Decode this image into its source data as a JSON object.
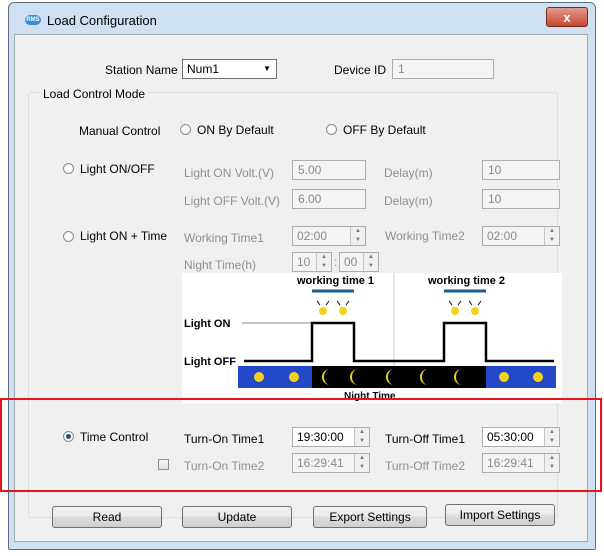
{
  "window": {
    "title": "Load Configuration",
    "close_symbol": "x",
    "app_icon_text": "RMS"
  },
  "station": {
    "label": "Station Name",
    "value": "Num1"
  },
  "device": {
    "label": "Device ID",
    "value": "1"
  },
  "group_label": "Load Control Mode",
  "manual": {
    "label": "Manual Control",
    "on_default": "ON By Default",
    "off_default": "OFF By Default"
  },
  "light_onoff": {
    "label": "Light ON/OFF",
    "on_volt_label": "Light ON  Volt.(V)",
    "on_volt": "5.00",
    "off_volt_label": "Light OFF Volt.(V)",
    "off_volt": "6.00",
    "delay_label": "Delay(m)",
    "delay1": "10",
    "delay2": "10"
  },
  "light_time": {
    "label": "Light ON + Time",
    "wt1_label": "Working Time1",
    "wt1": "02:00",
    "wt2_label": "Working Time2",
    "wt2": "02:00",
    "night_label": "Night Time(h)",
    "night_h": "10",
    "sep": ":",
    "night_m": "00"
  },
  "diagram": {
    "wt1": "working time 1",
    "wt2": "working time 2",
    "light_on": "Light ON",
    "light_off": "Light OFF",
    "night": "Night Time",
    "colors": {
      "sun_bg": "#2449c8",
      "moon_bg": "#000000",
      "sun": "#f5d21a"
    }
  },
  "time_control": {
    "label": "Time Control",
    "on1_label": "Turn-On Time1",
    "on1": "19:30:00",
    "off1_label": "Turn-Off Time1",
    "off1": "05:30:00",
    "on2_label": "Turn-On Time2",
    "on2": "16:29:41",
    "off2_label": "Turn-Off Time2",
    "off2": "16:29:41"
  },
  "buttons": {
    "read": "Read",
    "update": "Update",
    "export": "Export Settings",
    "import": "Import Settings"
  },
  "highlight_color": "#e8141c"
}
